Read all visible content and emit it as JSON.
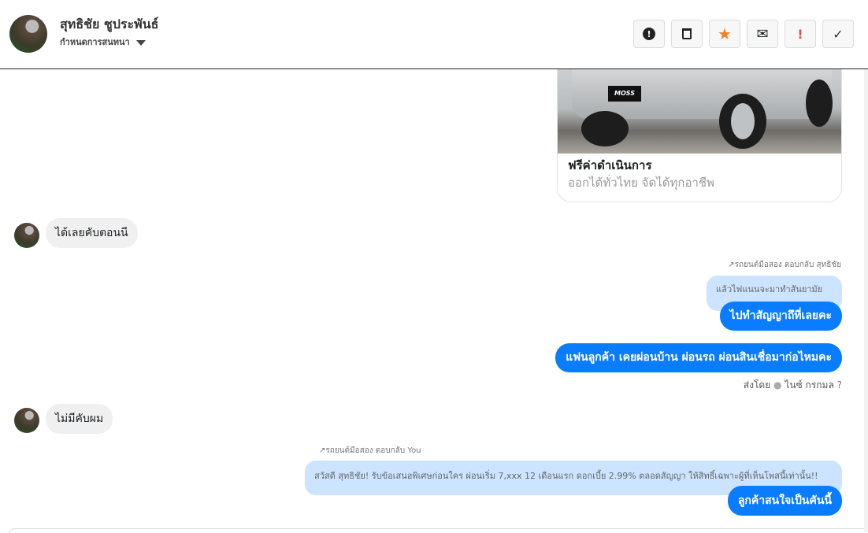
{
  "header": {
    "name": "สุทธิชัย ชูประพันธ์",
    "subtitle": "กำหนดการสนทนา",
    "toolbar": [
      {
        "name": "alert-circle",
        "glyph": "●"
      },
      {
        "name": "trash",
        "glyph": "🗑"
      },
      {
        "name": "star",
        "glyph": "★",
        "color": "#f48024"
      },
      {
        "name": "envelope",
        "glyph": "✉"
      },
      {
        "name": "exclamation",
        "glyph": "!",
        "color": "#d9534f"
      },
      {
        "name": "check",
        "glyph": "✓"
      }
    ]
  },
  "card": {
    "plate": "MOSS",
    "title": "ฟรีค่าดำเนินการ",
    "subtitle": "ออกได้ทั่วไทย จัดได้ทุกอาชีพ"
  },
  "messages": {
    "m1": "ได้เลยคับตอนนี",
    "r1_label": "รถยนต์มือสอง ตอบกลับ สุทธิชัย",
    "r1_quote": "แล้วไฟแนนจะมาทำสันยามัย",
    "r1_text": "ไปทำสัญญาถึที่เลยคะ",
    "m2": "แฟนลูกค้า เคยผ่อนบ้าน ผ่อนรถ ผ่อนสินเชื่อมาก่อไหมคะ",
    "sent_by": "ส่งโดย",
    "sender": "ไนซ์ กรกมล",
    "m3": "ไม่มีคับผม",
    "r2_label": "รถยนต์มือสอง ตอบกลับ You",
    "r2_quote": "สวัสดี สุทธิชัย! รับข้อเสนอพิเศษก่อนใคร ผ่อนเริ่ม 7,xxx 12 เดือนแรก ดอกเบี้ย 2.99% ตลอดสัญญา ให้สิทธิ์เฉพาะผู้ที่เห็นโพสนี้เท่านั้น!!",
    "r2_text": "ลูกค้าสนใจเป็นคันนี้"
  },
  "colors": {
    "accent": "#0a7cff",
    "quote": "#cce4ff"
  }
}
